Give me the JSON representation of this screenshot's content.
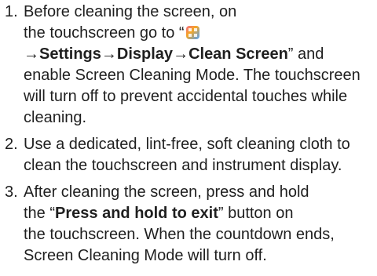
{
  "steps": [
    {
      "number": "1.",
      "line1": "Before cleaning the screen, on",
      "line2_prefix": "the touchscreen go to “",
      "app_icon": "app-launcher-icon",
      "path": {
        "arrow": "→",
        "settings": "Settings",
        "display": "Display",
        "clean_screen": "Clean Screen"
      },
      "after_path": "” and enable Screen Cleaning Mode. The touchscreen will turn off to prevent accidental touches while cleaning."
    },
    {
      "number": "2.",
      "text": "Use a dedicated, lint-free, soft cleaning cloth to clean the touchscreen and instrument display."
    },
    {
      "number": "3.",
      "line1": "After cleaning the screen, press and hold",
      "line2_prefix": "the “",
      "button_name": "Press and hold to exit",
      "line2_suffix": "” button on",
      "rest": "the touchscreen. When the countdown ends, Screen Cleaning Mode will turn off."
    }
  ]
}
